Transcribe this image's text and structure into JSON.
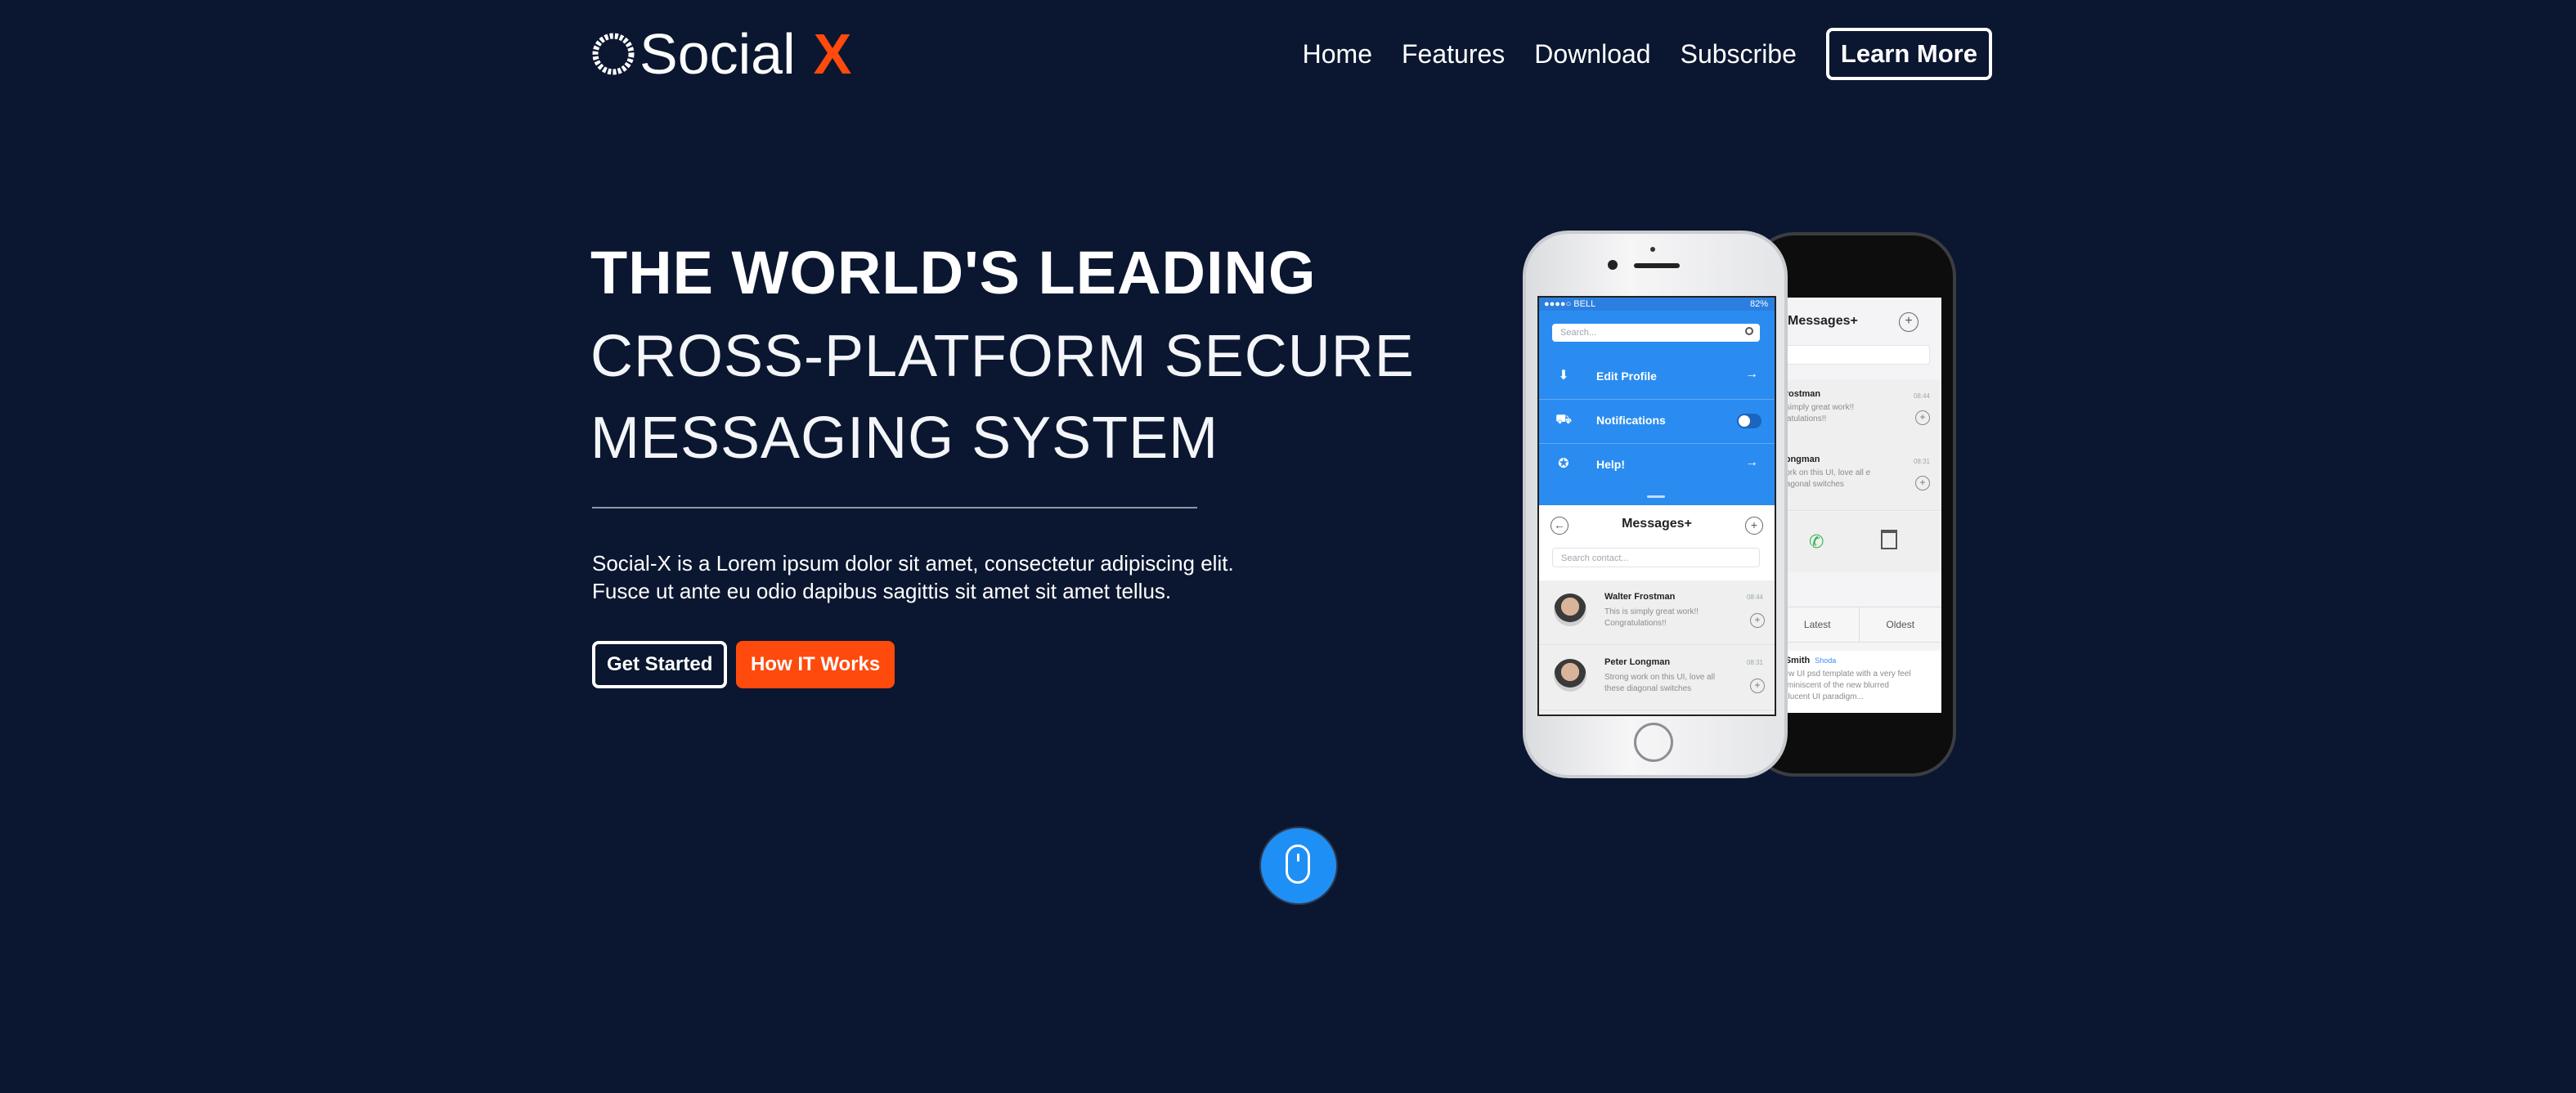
{
  "brand": {
    "name": "Social",
    "accent": "X",
    "accent_color": "#ff4a0d",
    "icon": "circle-logo-icon"
  },
  "nav": {
    "items": [
      "Home",
      "Features",
      "Download",
      "Subscribe"
    ],
    "cta": "Learn More"
  },
  "hero": {
    "title_bold": "THE WORLD'S LEADING",
    "title_line2": "CROSS-PLATFORM SECURE",
    "title_line3": "MESSAGING SYSTEM",
    "description_line1": "Social-X is a Lorem ipsum dolor sit amet, consectetur adipiscing elit.",
    "description_line2": "Fusce ut ante eu odio dapibus sagittis sit amet sit amet tellus.",
    "primary_button": "Get Started",
    "secondary_button": "How IT Works",
    "secondary_color": "#ff4a0d"
  },
  "phone_front": {
    "status_carrier": "●●●●○ BELL",
    "status_battery": "82%",
    "search_placeholder": "Search...",
    "menu": [
      {
        "icon": "download-icon",
        "label": "Edit Profile",
        "control": "arrow"
      },
      {
        "icon": "car-icon",
        "label": "Notifications",
        "control": "toggle"
      },
      {
        "icon": "lifebuoy-icon",
        "label": "Help!",
        "control": "arrow"
      }
    ],
    "messages_title": "Messages+",
    "contact_placeholder": "Search contact...",
    "messages": [
      {
        "name": "Walter Frostman",
        "text": "This is simply great work!! Congratulations!!",
        "time": "08:44"
      },
      {
        "name": "Peter Longman",
        "text": "Strong work on this UI, love all these diagonal switches",
        "time": "08:31"
      }
    ]
  },
  "phone_back": {
    "title": "Messages+",
    "messages": [
      {
        "name": "Frostman",
        "text": "s simply great work!! gratulations!!",
        "time": "08:44"
      },
      {
        "name": "Longman",
        "text": "work on this UI, love all e diagonal switches",
        "time": "08:31"
      }
    ],
    "tabs": [
      "Latest",
      "Oldest"
    ],
    "last_name": "t Smith",
    "last_tag": "Shoda",
    "last_text": "new UI psd template with a very feel reminiscent of the new blurred nslucent UI paradigm..."
  },
  "scroll_indicator": {
    "icon": "mouse-icon",
    "color": "#1e8ff5"
  }
}
